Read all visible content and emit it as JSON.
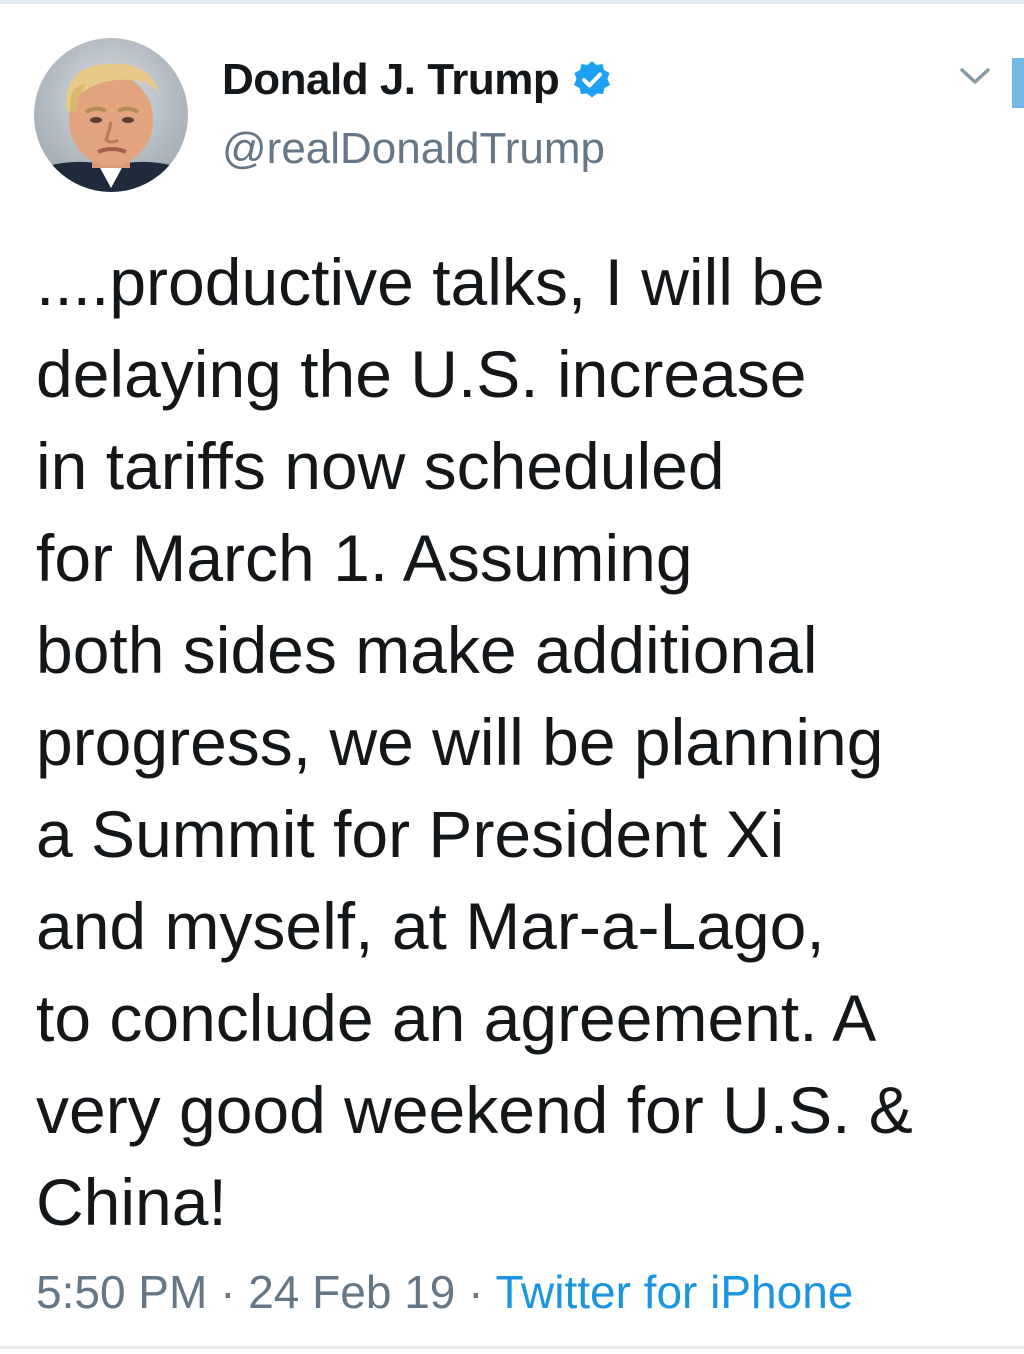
{
  "tweet": {
    "author": {
      "name": "Donald J. Trump",
      "handle": "@realDonaldTrump",
      "verified": true,
      "avatar_icon": "profile-photo",
      "verified_icon": "verified-badge-icon"
    },
    "text": "....productive talks, I will be\ndelaying the U.S. increase\nin tariffs now scheduled\nfor March 1. Assuming\nboth sides make additional\nprogress, we will be planning\na Summit for President Xi\nand myself, at Mar-a-Lago,\nto conclude an agreement. A\nvery good weekend for U.S. &\nChina!",
    "time": "5:50 PM",
    "separator": " · ",
    "date": "24 Feb 19",
    "source": "Twitter for iPhone",
    "menu_icon": "chevron-down-icon"
  },
  "colors": {
    "text": "#14171a",
    "secondary": "#657786",
    "link": "#1b95e0",
    "verified": "#1da1f2",
    "divider": "#e6ecf0"
  }
}
